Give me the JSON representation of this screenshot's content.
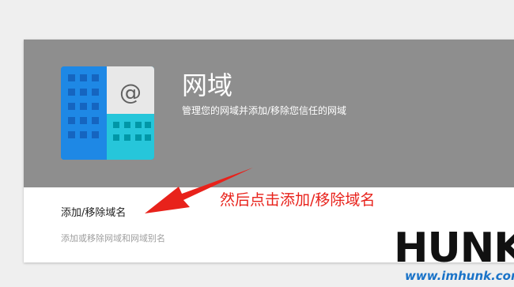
{
  "card": {
    "title": "网域",
    "subtitle": "管理您的网域并添加/移除您信任的网域",
    "action_label": "添加/移除域名",
    "action_description": "添加或移除网域和网域别名",
    "icon": "domains-building-icon",
    "header_color": "#8e8e8e"
  },
  "annotation": {
    "text": "然后点击添加/移除域名",
    "color": "#e8221b"
  },
  "watermark": {
    "logo_text": "HUNK",
    "url": "www.imhunk.com"
  }
}
